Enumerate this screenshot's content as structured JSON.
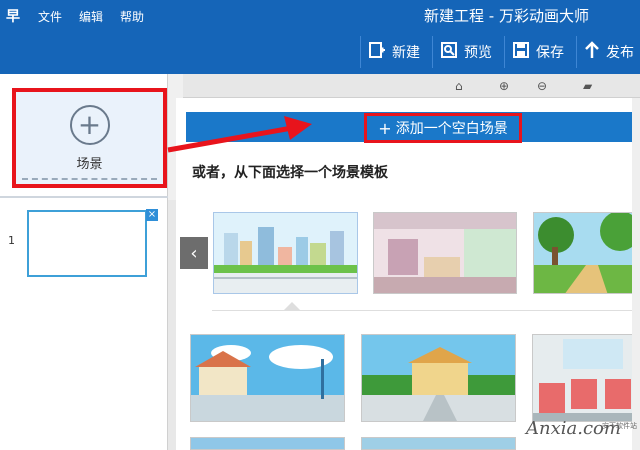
{
  "titlebar": {
    "logo": "早",
    "menu": [
      "文件",
      "编辑",
      "帮助"
    ],
    "title": "新建工程 - 万彩动画大师"
  },
  "toolbar": {
    "new_label": "新建",
    "preview_label": "预览",
    "save_label": "保存",
    "publish_label": "发布"
  },
  "left_panel": {
    "add_scene_label": "场景",
    "scene_number": "1",
    "close_symbol": "×"
  },
  "dialog": {
    "add_blank_label": "添加一个空白场景",
    "hint": "或者，从下面选择一个场景模板",
    "prev_symbol": "‹"
  },
  "watermark": {
    "brand": "Anxia.com",
    "sub": "安下软件站"
  },
  "colors": {
    "primary": "#1565b8",
    "accent_red": "#e8141c",
    "button_blue": "#1a78c9"
  }
}
